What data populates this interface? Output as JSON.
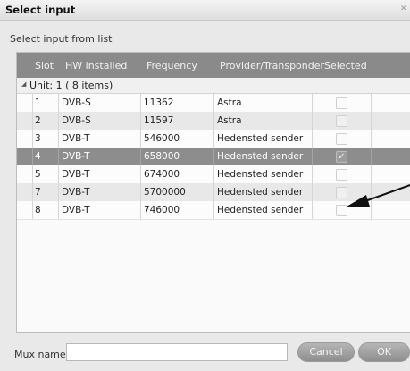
{
  "window": {
    "title": "Select input",
    "close_icon": "close-icon"
  },
  "instruction": "Select input from list",
  "table": {
    "columns": [
      "Slot",
      "HW installed",
      "Frequency",
      "Provider/Transponder",
      "Selected"
    ],
    "group_label": "Unit: 1 ( 8 items)",
    "rows": [
      {
        "slot": "1",
        "hw": "DVB-S",
        "frequency": "11362",
        "provider": "Astra",
        "selected": false,
        "state": "normal"
      },
      {
        "slot": "2",
        "hw": "DVB-S",
        "frequency": "11597",
        "provider": "Astra",
        "selected": false,
        "state": "alt"
      },
      {
        "slot": "3",
        "hw": "DVB-T",
        "frequency": "546000",
        "provider": "Hedensted sender",
        "selected": false,
        "state": "normal"
      },
      {
        "slot": "4",
        "hw": "DVB-T",
        "frequency": "658000",
        "provider": "Hedensted sender",
        "selected": true,
        "state": "selected"
      },
      {
        "slot": "5",
        "hw": "DVB-T",
        "frequency": "674000",
        "provider": "Hedensted sender",
        "selected": false,
        "state": "normal"
      },
      {
        "slot": "7",
        "hw": "DVB-T",
        "frequency": "5700000",
        "provider": "Hedensted sender",
        "selected": false,
        "state": "alt"
      },
      {
        "slot": "8",
        "hw": "DVB-T",
        "frequency": "746000",
        "provider": "Hedensted sender",
        "selected": false,
        "state": "normal"
      }
    ]
  },
  "footer": {
    "mux_label": "Mux name",
    "mux_value": "",
    "cancel_label": "Cancel",
    "ok_label": "OK"
  },
  "colors": {
    "header_bg": "#8a8a8a",
    "selected_row_bg": "#8d8d8d",
    "button_bg": "#9e9e9e"
  }
}
